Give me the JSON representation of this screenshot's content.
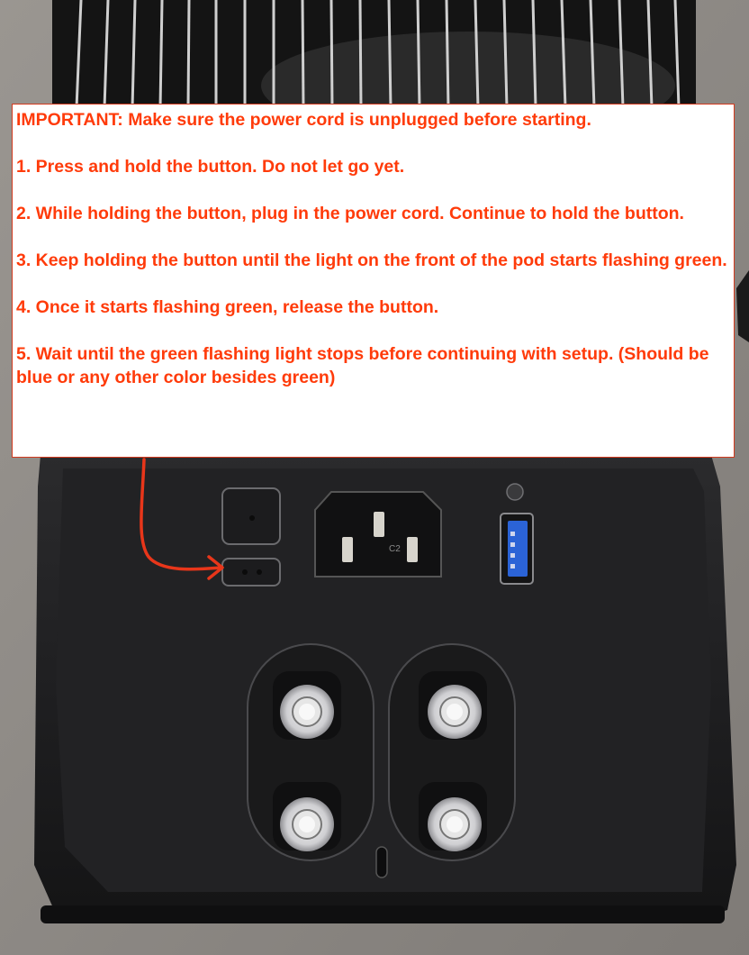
{
  "photo": {
    "subject": "back panel of a black device with reset button, power socket, USB port and four hose connectors",
    "socket_marking": "C2",
    "arrow_color": "#e8361a"
  },
  "instructions": {
    "important": "IMPORTANT: Make sure the power cord is unplugged before starting.",
    "steps": [
      "1. Press and hold the button. Do not let go yet.",
      "2. While holding the button, plug in the power cord. Continue to hold the button.",
      "3. Keep holding the button until the light on the front of the pod starts flashing green.",
      "4. Once it starts flashing green, release the button.",
      "5. Wait until the green flashing light stops before continuing with setup. (Should be blue or any other color besides green)"
    ],
    "text_color": "#ff3b0a",
    "border_color": "#d23a1e"
  }
}
